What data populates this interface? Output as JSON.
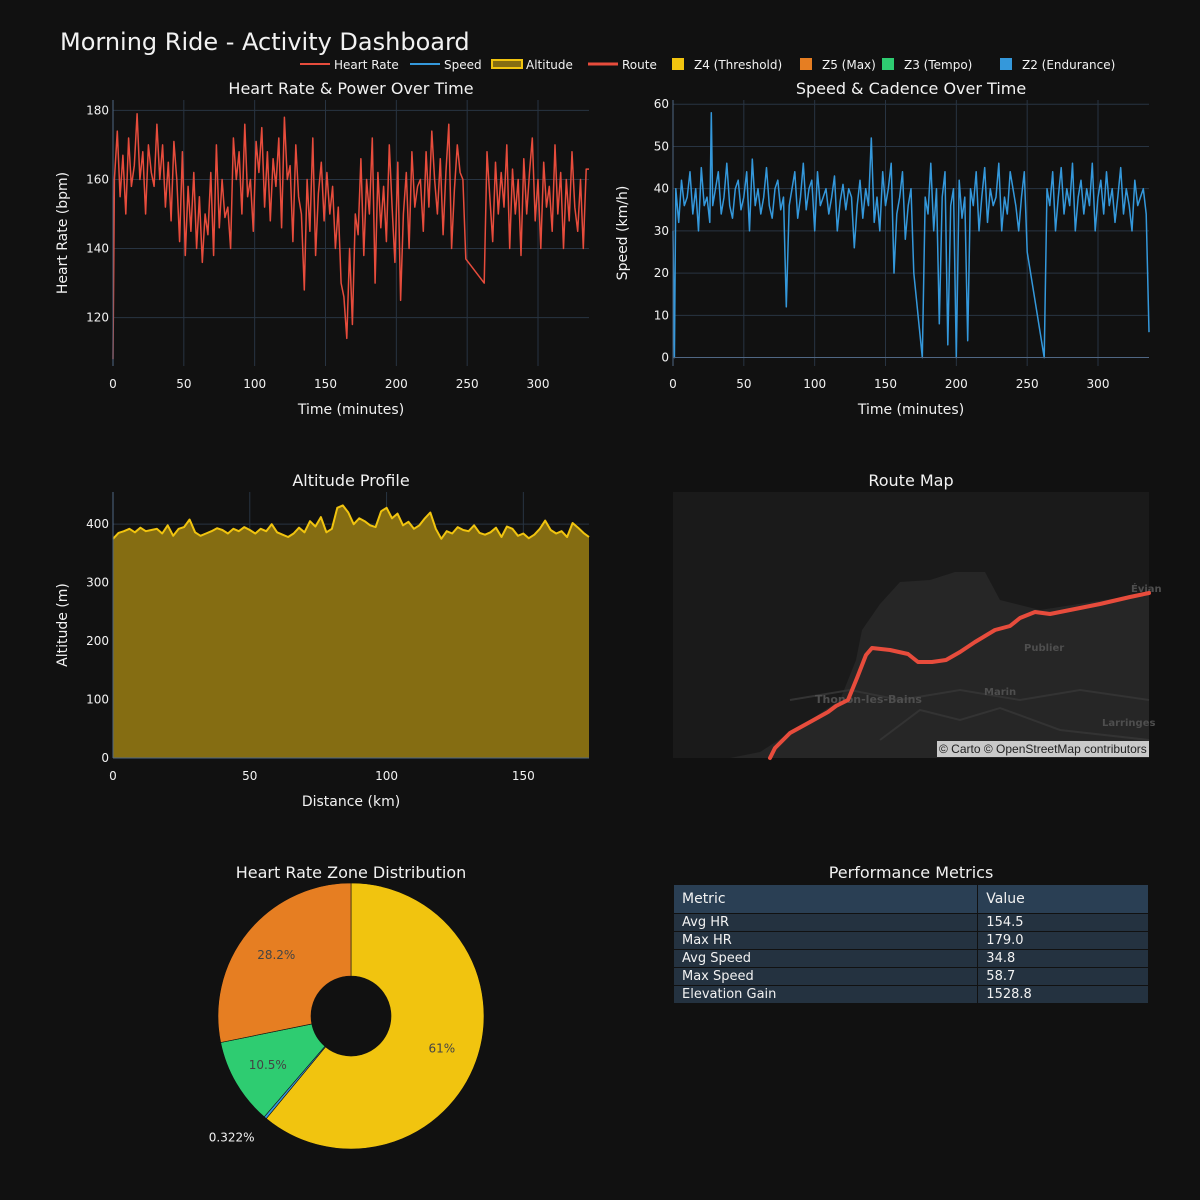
{
  "title": "Morning Ride - Activity Dashboard",
  "colors": {
    "bg": "#111111",
    "grid": "#283442",
    "hr": "#e74c3c",
    "speed": "#3498db",
    "alt": "#f1c40f",
    "alt_fill": "#856d12",
    "route": "#e74c3c",
    "z4": "#f1c40f",
    "z5": "#e67e22",
    "z3": "#2ecc71",
    "z2": "#3498db"
  },
  "legend": [
    {
      "label": "Heart Rate",
      "kind": "line",
      "color": "#e74c3c"
    },
    {
      "label": "Speed",
      "kind": "line",
      "color": "#3498db"
    },
    {
      "label": "Altitude",
      "kind": "area",
      "color": "#f1c40f"
    },
    {
      "label": "Route",
      "kind": "line",
      "color": "#e74c3c"
    },
    {
      "label": "Z4 (Threshold)",
      "kind": "box",
      "color": "#f1c40f"
    },
    {
      "label": "Z5 (Max)",
      "kind": "box",
      "color": "#e67e22"
    },
    {
      "label": "Z3 (Tempo)",
      "kind": "box",
      "color": "#2ecc71"
    },
    {
      "label": "Z2 (Endurance)",
      "kind": "box",
      "color": "#3498db"
    }
  ],
  "chart_data": [
    {
      "type": "line",
      "title": "Heart Rate & Power Over Time",
      "xlabel": "Time (minutes)",
      "ylabel": "Heart Rate (bpm)",
      "xlim": [
        0,
        336
      ],
      "ylim": [
        106,
        183
      ],
      "xticks": [
        0,
        50,
        100,
        150,
        200,
        250,
        300
      ],
      "yticks": [
        120,
        140,
        160,
        180
      ],
      "series": [
        {
          "name": "Heart Rate",
          "x": [
            0,
            1,
            3,
            5,
            7,
            9,
            11,
            13,
            15,
            17,
            19,
            21,
            23,
            25,
            27,
            29,
            31,
            33,
            35,
            37,
            39,
            41,
            43,
            45,
            47,
            49,
            51,
            53,
            55,
            57,
            59,
            61,
            63,
            65,
            67,
            69,
            71,
            73,
            75,
            77,
            79,
            81,
            83,
            85,
            87,
            89,
            91,
            93,
            95,
            97,
            99,
            101,
            103,
            105,
            107,
            109,
            111,
            113,
            115,
            117,
            119,
            121,
            123,
            125,
            127,
            129,
            131,
            133,
            135,
            137,
            139,
            141,
            143,
            145,
            147,
            149,
            151,
            153,
            155,
            157,
            159,
            161,
            163,
            165,
            167,
            169,
            171,
            173,
            175,
            177,
            179,
            181,
            183,
            185,
            187,
            189,
            191,
            193,
            195,
            197,
            199,
            201,
            203,
            205,
            207,
            209,
            211,
            213,
            215,
            217,
            219,
            221,
            223,
            225,
            227,
            229,
            231,
            233,
            235,
            237,
            239,
            241,
            243,
            245,
            247,
            249,
            262,
            264,
            266,
            268,
            270,
            272,
            274,
            276,
            278,
            280,
            282,
            284,
            286,
            288,
            290,
            292,
            294,
            296,
            298,
            300,
            302,
            304,
            306,
            308,
            310,
            312,
            314,
            316,
            318,
            320,
            322,
            324,
            326,
            328,
            330,
            332,
            334,
            336
          ],
          "y": [
            108,
            160,
            174,
            155,
            167,
            150,
            172,
            158,
            164,
            179,
            160,
            168,
            150,
            170,
            162,
            158,
            176,
            160,
            170,
            152,
            165,
            148,
            171,
            160,
            142,
            168,
            138,
            158,
            145,
            162,
            140,
            155,
            136,
            150,
            144,
            162,
            138,
            170,
            146,
            160,
            149,
            152,
            140,
            172,
            160,
            168,
            150,
            176,
            155,
            160,
            145,
            171,
            162,
            175,
            152,
            168,
            148,
            166,
            158,
            172,
            146,
            178,
            160,
            164,
            142,
            170,
            155,
            150,
            128,
            160,
            145,
            172,
            138,
            156,
            165,
            148,
            162,
            150,
            158,
            140,
            152,
            130,
            126,
            114,
            140,
            118,
            150,
            144,
            166,
            138,
            160,
            150,
            172,
            130,
            162,
            146,
            158,
            142,
            170,
            152,
            136,
            165,
            125,
            150,
            162,
            140,
            168,
            152,
            158,
            160,
            145,
            168,
            152,
            174,
            160,
            150,
            166,
            144,
            162,
            176,
            140,
            157,
            170,
            162,
            160,
            137,
            130,
            168,
            155,
            142,
            165,
            150,
            162,
            152,
            170,
            140,
            163,
            150,
            160,
            138,
            166,
            150,
            162,
            172,
            148,
            160,
            140,
            165,
            152,
            158,
            145,
            170,
            150,
            162,
            140,
            160,
            148,
            168,
            152,
            145,
            160,
            140,
            163,
            163
          ]
        }
      ]
    },
    {
      "type": "line",
      "title": "Speed & Cadence Over Time",
      "xlabel": "Time (minutes)",
      "ylabel": "Speed (km/h)",
      "xlim": [
        0,
        336
      ],
      "ylim": [
        -2,
        61
      ],
      "xticks": [
        0,
        50,
        100,
        150,
        200,
        250,
        300
      ],
      "yticks": [
        0,
        10,
        20,
        30,
        40,
        50,
        60
      ],
      "series": [
        {
          "name": "Speed",
          "x": [
            0,
            1,
            2,
            4,
            6,
            8,
            10,
            12,
            14,
            16,
            18,
            20,
            22,
            24,
            26,
            27,
            28,
            30,
            32,
            34,
            36,
            38,
            40,
            42,
            44,
            46,
            48,
            50,
            52,
            54,
            56,
            58,
            60,
            62,
            64,
            66,
            68,
            70,
            72,
            74,
            76,
            78,
            80,
            82,
            84,
            86,
            88,
            90,
            92,
            94,
            96,
            98,
            100,
            102,
            104,
            106,
            108,
            110,
            112,
            114,
            116,
            118,
            120,
            122,
            124,
            126,
            128,
            130,
            132,
            134,
            136,
            138,
            140,
            142,
            144,
            146,
            148,
            150,
            152,
            154,
            156,
            158,
            160,
            162,
            164,
            166,
            168,
            170,
            176,
            178,
            180,
            182,
            184,
            186,
            188,
            190,
            192,
            194,
            196,
            198,
            200,
            202,
            204,
            206,
            208,
            210,
            212,
            214,
            216,
            218,
            220,
            222,
            224,
            226,
            228,
            230,
            232,
            234,
            236,
            238,
            240,
            242,
            244,
            246,
            248,
            250,
            262,
            264,
            266,
            268,
            270,
            272,
            274,
            276,
            278,
            280,
            282,
            284,
            286,
            288,
            290,
            292,
            294,
            296,
            298,
            300,
            302,
            304,
            306,
            308,
            310,
            312,
            314,
            316,
            318,
            320,
            322,
            324,
            326,
            328,
            330,
            332,
            334,
            336
          ],
          "y": [
            30,
            0,
            40,
            32,
            42,
            36,
            38,
            44,
            34,
            40,
            30,
            45,
            36,
            38,
            32,
            58,
            36,
            40,
            44,
            34,
            38,
            46,
            36,
            33,
            40,
            42,
            35,
            38,
            44,
            30,
            47,
            36,
            40,
            34,
            38,
            45,
            36,
            33,
            40,
            42,
            35,
            38,
            12,
            36,
            40,
            44,
            33,
            38,
            46,
            35,
            40,
            42,
            30,
            44,
            36,
            38,
            40,
            34,
            38,
            43,
            30,
            37,
            41,
            35,
            40,
            38,
            26,
            36,
            42,
            33,
            40,
            36,
            52,
            32,
            38,
            30,
            44,
            36,
            40,
            46,
            20,
            34,
            38,
            44,
            28,
            36,
            40,
            20,
            0,
            38,
            34,
            46,
            30,
            40,
            8,
            38,
            44,
            3,
            36,
            40,
            0,
            42,
            33,
            38,
            4,
            40,
            36,
            44,
            30,
            38,
            45,
            32,
            40,
            36,
            38,
            46,
            30,
            38,
            34,
            44,
            40,
            36,
            30,
            38,
            44,
            25,
            0,
            40,
            36,
            44,
            30,
            38,
            45,
            34,
            40,
            36,
            46,
            30,
            38,
            42,
            34,
            40,
            36,
            46,
            30,
            38,
            42,
            34,
            44,
            36,
            40,
            32,
            38,
            45,
            34,
            40,
            36,
            30,
            42,
            36,
            38,
            40,
            34,
            6
          ]
        }
      ]
    },
    {
      "type": "area",
      "title": "Altitude Profile",
      "xlabel": "Distance (km)",
      "ylabel": "Altitude (m)",
      "xlim": [
        0,
        174
      ],
      "ylim": [
        0,
        455
      ],
      "xticks": [
        0,
        50,
        100,
        150
      ],
      "yticks": [
        0,
        100,
        200,
        300,
        400
      ],
      "series": [
        {
          "name": "Altitude",
          "x": [
            0,
            2,
            4,
            6,
            8,
            10,
            12,
            14,
            16,
            18,
            20,
            22,
            24,
            26,
            28,
            30,
            32,
            34,
            36,
            38,
            40,
            42,
            44,
            46,
            48,
            50,
            52,
            54,
            56,
            58,
            60,
            62,
            64,
            66,
            68,
            70,
            72,
            74,
            76,
            78,
            80,
            82,
            84,
            86,
            88,
            90,
            92,
            94,
            96,
            98,
            100,
            102,
            104,
            106,
            108,
            110,
            112,
            114,
            116,
            118,
            120,
            122,
            124,
            126,
            128,
            130,
            132,
            134,
            136,
            138,
            140,
            142,
            144,
            146,
            148,
            150,
            152,
            154,
            156,
            158,
            160,
            162,
            164,
            166,
            168,
            170,
            172,
            174
          ],
          "y": [
            375,
            385,
            388,
            392,
            386,
            394,
            388,
            390,
            392,
            384,
            398,
            380,
            392,
            395,
            408,
            386,
            380,
            384,
            388,
            393,
            390,
            384,
            392,
            388,
            395,
            390,
            384,
            392,
            388,
            400,
            386,
            382,
            378,
            384,
            394,
            386,
            405,
            396,
            412,
            386,
            392,
            428,
            432,
            420,
            400,
            410,
            405,
            398,
            395,
            422,
            428,
            410,
            418,
            398,
            404,
            392,
            398,
            410,
            420,
            392,
            375,
            388,
            384,
            395,
            390,
            388,
            398,
            385,
            382,
            386,
            394,
            378,
            396,
            392,
            380,
            384,
            376,
            382,
            392,
            406,
            390,
            384,
            388,
            378,
            402,
            394,
            385,
            378
          ]
        }
      ]
    },
    {
      "type": "pie",
      "title": "Heart Rate Zone Distribution",
      "hole": 0.3,
      "labels": [
        "Z4 (Threshold)",
        "Z5 (Max)",
        "Z3 (Tempo)",
        "Z2 (Endurance)"
      ],
      "values": [
        61,
        28.2,
        10.5,
        0.322
      ],
      "text": [
        "61%",
        "28.2%",
        "10.5%",
        "0.322%"
      ]
    },
    {
      "type": "table",
      "title": "Performance Metrics",
      "header": [
        "Metric",
        "Value"
      ],
      "rows": [
        [
          "Avg HR",
          "154.5"
        ],
        [
          "Max HR",
          "179.0"
        ],
        [
          "Avg Speed",
          "34.8"
        ],
        [
          "Max Speed",
          "58.7"
        ],
        [
          "Elevation Gain",
          "1528.8"
        ]
      ]
    }
  ],
  "map": {
    "title": "Route Map",
    "attribution": "© Carto © OpenStreetMap contributors",
    "places": [
      "Thonon-les-Bains",
      "Publier",
      "Marin",
      "Larringes",
      "Évian"
    ]
  }
}
